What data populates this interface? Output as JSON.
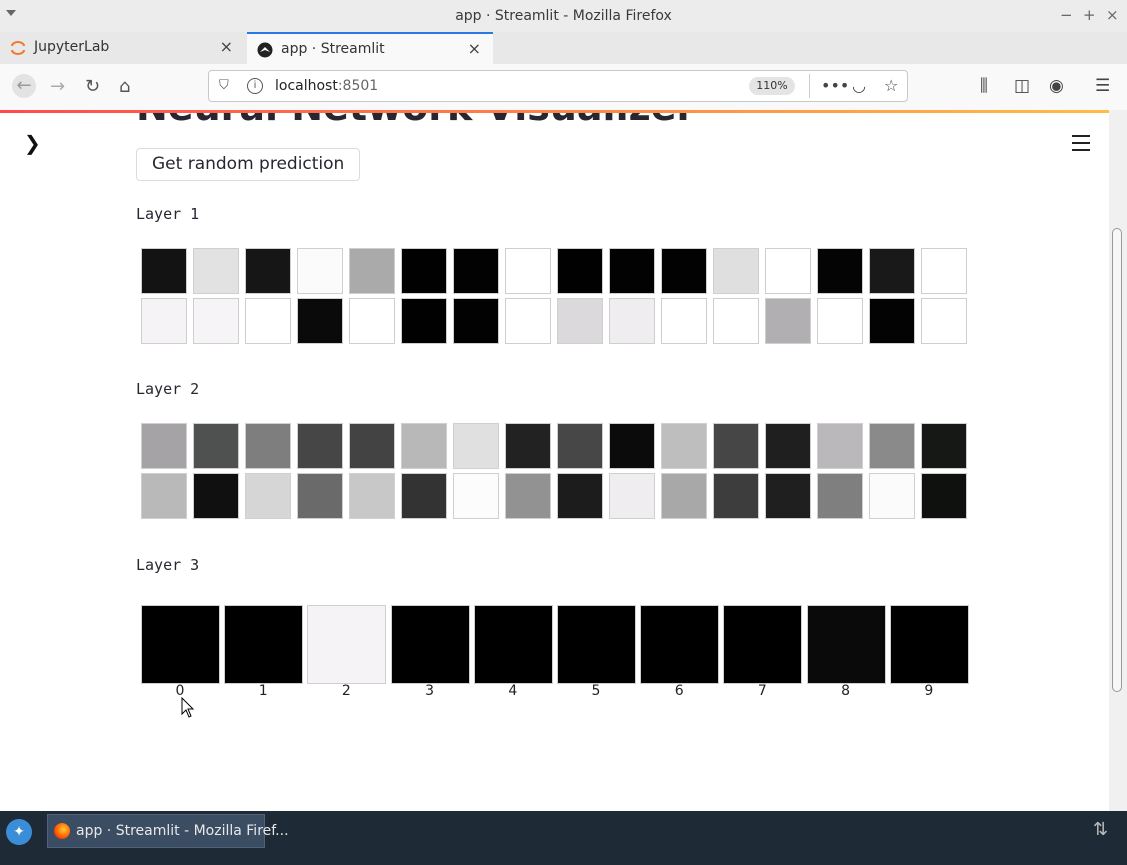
{
  "window": {
    "title": "app · Streamlit - Mozilla Firefox",
    "controls": [
      "−",
      "+",
      "×"
    ]
  },
  "tabs": [
    {
      "label": "JupyterLab",
      "icon": "jupyter-icon",
      "active": false,
      "close": "×"
    },
    {
      "label": "app · Streamlit",
      "icon": "streamlit-icon",
      "active": true,
      "close": "×"
    }
  ],
  "new_tab": "+",
  "url": {
    "host": "localhost",
    "port": ":8501",
    "zoom": "110%"
  },
  "page": {
    "heading": "Neural Network Visualizer",
    "button_label": "Get random prediction",
    "layers": [
      {
        "label": "Layer 1",
        "rows": [
          [
            "#131313",
            "#e2e2e2",
            "#161616",
            "#fbfbfb",
            "#aaaaaa",
            "#010101",
            "#020202",
            "#ffffff",
            "#010101",
            "#020202",
            "#020202",
            "#dfdfdf",
            "#ffffff",
            "#040404",
            "#191919",
            "#ffffff"
          ],
          [
            "#f5f3f5",
            "#f6f4f6",
            "#ffffff",
            "#0a0a0a",
            "#ffffff",
            "#010101",
            "#020202",
            "#ffffff",
            "#dcd9dc",
            "#efedef",
            "#ffffff",
            "#ffffff",
            "#b2afb2",
            "#ffffff",
            "#030303",
            "#ffffff"
          ]
        ]
      },
      {
        "label": "Layer 2",
        "rows": [
          [
            "#a5a3a5",
            "#4f5151",
            "#7e7e7e",
            "#464646",
            "#434343",
            "#b9b8b9",
            "#dfe0df",
            "#222222",
            "#474747",
            "#0b0b0b",
            "#bebebe",
            "#464646",
            "#1e1f1e",
            "#bab8ba",
            "#8a8a8a",
            "#151815"
          ],
          [
            "#b9b9b9",
            "#101010",
            "#d5d6d5",
            "#6a6a6a",
            "#c9c8c9",
            "#333333",
            "#fdfcfd",
            "#939293",
            "#1c1c1c",
            "#efedef",
            "#a9a8a9",
            "#3d3d3d",
            "#1f1f1f",
            "#7f7f7f",
            "#fcfbfc",
            "#0e110e"
          ]
        ]
      },
      {
        "label": "Layer 3",
        "cells": [
          "#000000",
          "#000000",
          "#f5f3f5",
          "#000000",
          "#000000",
          "#000000",
          "#000000",
          "#000000",
          "#0a0a0a",
          "#000000"
        ],
        "output_labels": [
          "0",
          "1",
          "2",
          "3",
          "4",
          "5",
          "6",
          "7",
          "8",
          "9"
        ]
      }
    ]
  },
  "taskbar": {
    "task_label": "app · Streamlit - Mozilla Firef..."
  }
}
